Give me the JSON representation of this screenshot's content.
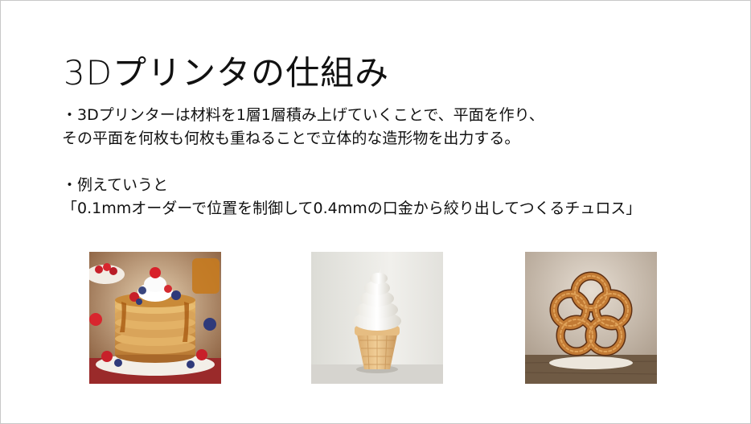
{
  "slide": {
    "title": "3Dプリンタの仕組み",
    "body_lines": [
      "・3Dプリンターは材料を1層1層積み上げていくことで、平面を作り、",
      "その平面を何枚も何枚も重ねることで立体的な造形物を出力する。",
      "・例えていうと",
      "「0.1mmオーダーで位置を制御して0.4mmの口金から絞り出してつくるチュロス」"
    ]
  },
  "images": [
    {
      "name": "pancake-stack-photo"
    },
    {
      "name": "soft-serve-ice-cream-photo"
    },
    {
      "name": "churro-knot-photo"
    }
  ]
}
